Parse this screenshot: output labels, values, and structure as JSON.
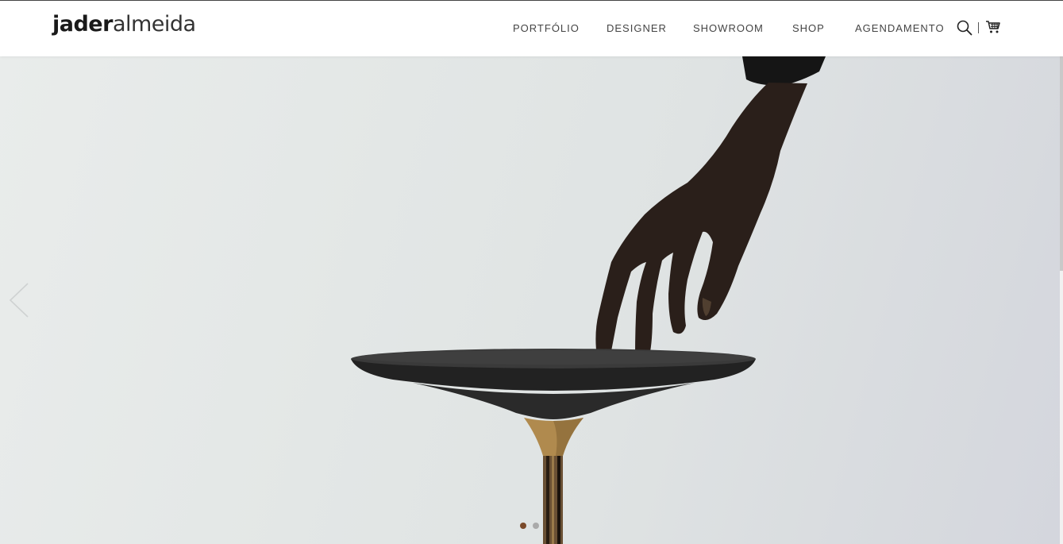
{
  "header": {
    "logo_bold": "jader",
    "logo_light": "almeida",
    "nav": [
      "PORTFÓLIO",
      "DESIGNER",
      "SHOWROOM",
      "SHOP",
      "AGENDAMENTO"
    ],
    "separator": "|"
  },
  "icons": {
    "search": "search-icon",
    "cart": "cart-icon",
    "prev": "chevron-left-icon"
  },
  "carousel": {
    "slide_count": 2,
    "active_slide": 1
  },
  "colors": {
    "active_dot": "#7a4a2a",
    "inactive_dot": "#aaaaaa",
    "table_top": "#2b2b2b",
    "brass": "#b08a4e"
  }
}
